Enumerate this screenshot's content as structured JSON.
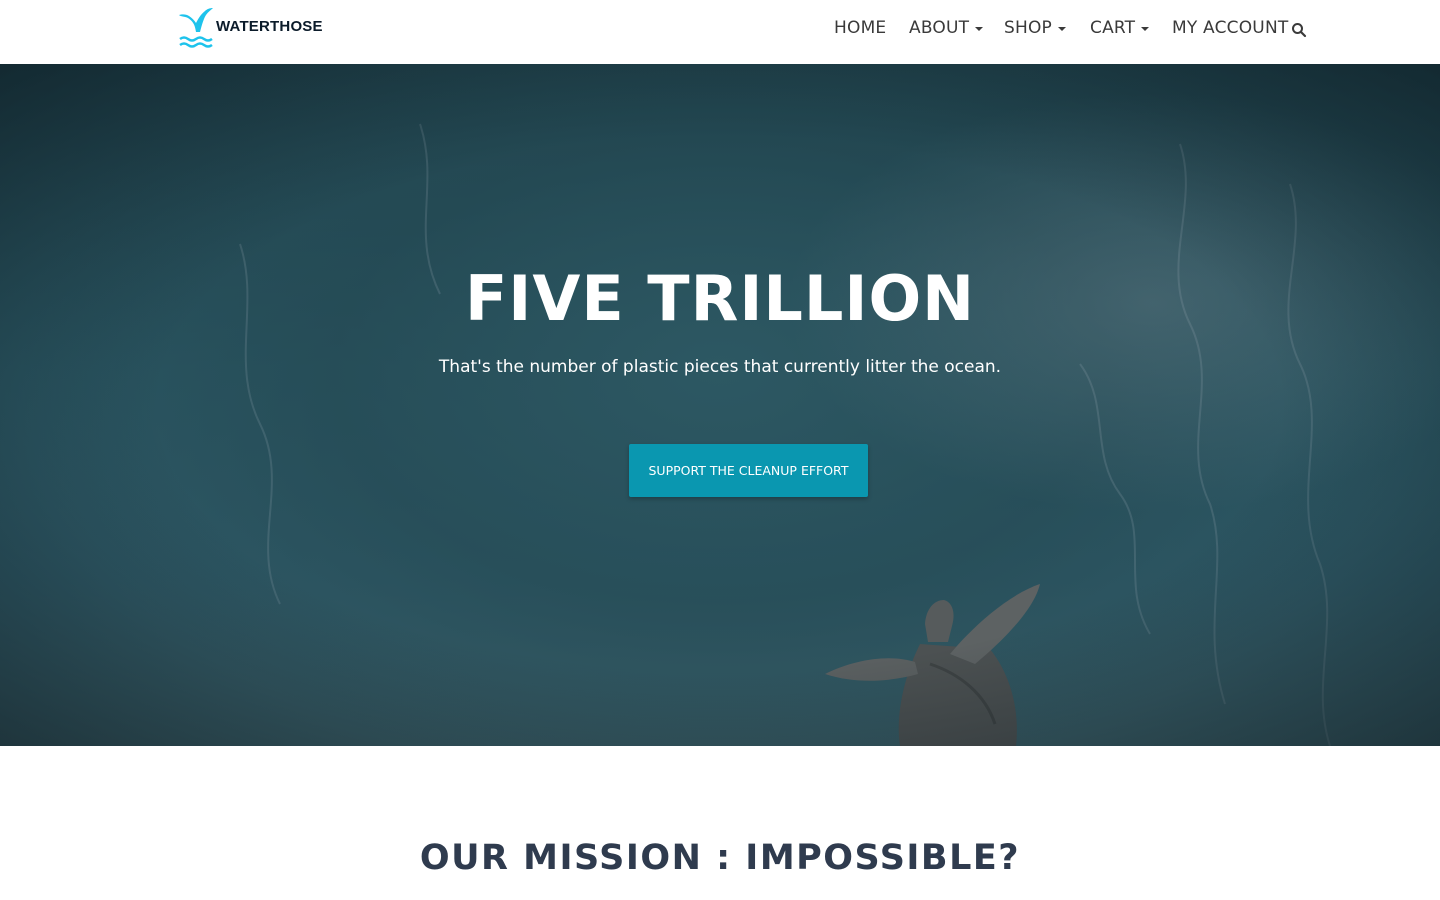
{
  "brand": {
    "name": "WATERTHOSE",
    "logo_icon": "whale-tail-icon",
    "accent": "#1ec3ec"
  },
  "nav": {
    "items": [
      {
        "label": "HOME",
        "dropdown": false
      },
      {
        "label": "ABOUT",
        "dropdown": true
      },
      {
        "label": "SHOP",
        "dropdown": true
      },
      {
        "label": "CART",
        "dropdown": true
      },
      {
        "label": "MY ACCOUNT",
        "dropdown": false
      }
    ],
    "search_icon": "search-icon"
  },
  "hero": {
    "title": "FIVE TRILLION",
    "subtitle": "That's the number of plastic pieces that currently litter the ocean.",
    "button_label": "SUPPORT THE CLEANUP EFFORT",
    "button_color": "#0a97b0"
  },
  "mission": {
    "title": "OUR MISSION : IMPOSSIBLE?"
  }
}
